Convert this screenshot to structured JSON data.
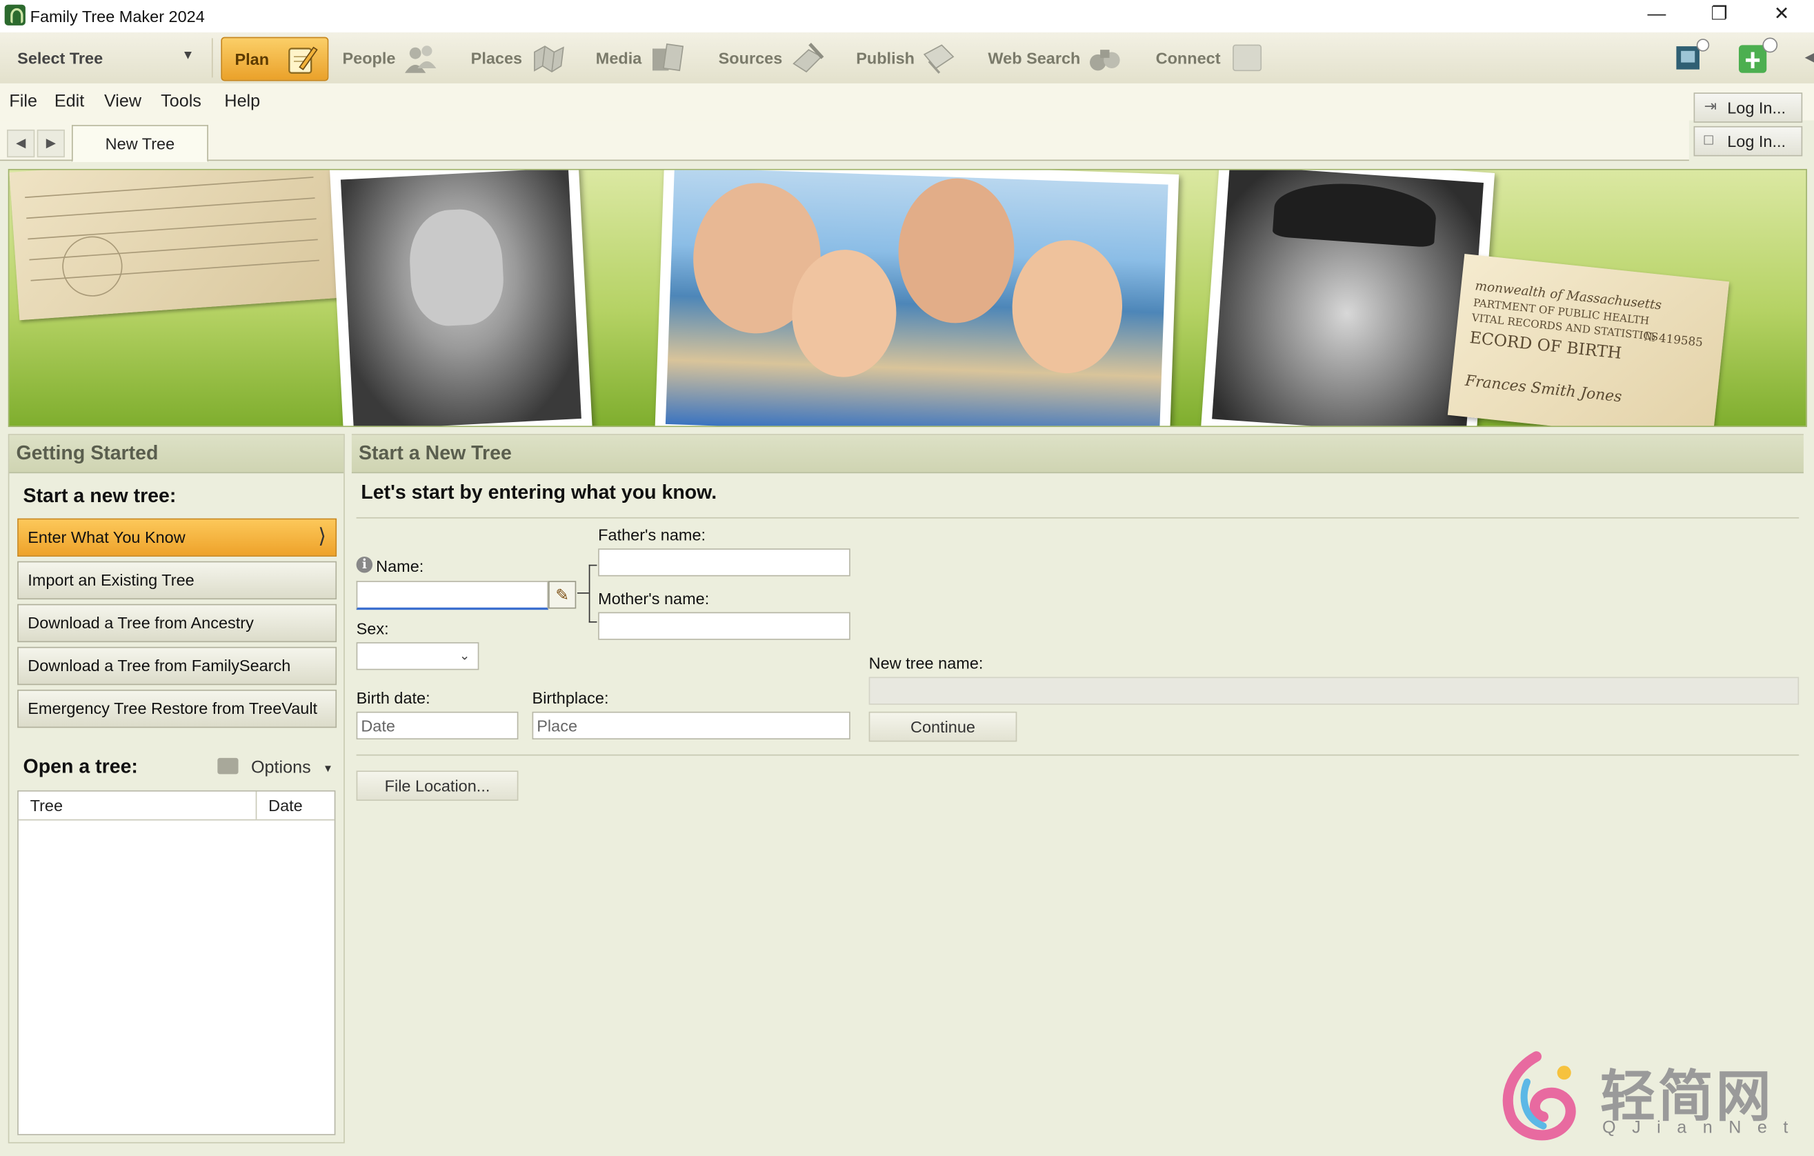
{
  "app": {
    "title": "Family Tree Maker 2024"
  },
  "toolbar": {
    "select_tree": "Select Tree",
    "items": [
      {
        "label": "Plan"
      },
      {
        "label": "People"
      },
      {
        "label": "Places"
      },
      {
        "label": "Media"
      },
      {
        "label": "Sources"
      },
      {
        "label": "Publish"
      },
      {
        "label": "Web Search"
      },
      {
        "label": "Connect"
      }
    ]
  },
  "menu": [
    "File",
    "Edit",
    "View",
    "Tools",
    "Help"
  ],
  "login": [
    "Log In...",
    "Log In..."
  ],
  "tabs": [
    {
      "label": "New Tree"
    }
  ],
  "banner": {
    "doc_right_text": [
      "monwealth of Massachusetts",
      "PARTMENT OF PUBLIC HEALTH",
      "VITAL RECORDS AND STATISTICS",
      "ECORD OF BIRTH",
      "№ 419585",
      "Frances Smith Jones"
    ]
  },
  "left_panel": {
    "header": "Getting Started",
    "start_title": "Start a new tree:",
    "buttons": [
      "Enter What You Know",
      "Import an Existing Tree",
      "Download a Tree from Ancestry",
      "Download a Tree from FamilySearch",
      "Emergency Tree Restore from TreeVault"
    ],
    "open_title": "Open a tree:",
    "options": "Options",
    "columns": [
      "Tree",
      "Date"
    ]
  },
  "right_panel": {
    "header": "Start a New Tree",
    "intro": "Let's start by entering what you know.",
    "name_label": "Name:",
    "father_label": "Father's name:",
    "mother_label": "Mother's name:",
    "sex_label": "Sex:",
    "birth_date_label": "Birth date:",
    "birth_date_placeholder": "Date",
    "birthplace_label": "Birthplace:",
    "birthplace_placeholder": "Place",
    "new_tree_name_label": "New tree name:",
    "continue_label": "Continue",
    "file_location_label": "File Location..."
  },
  "watermark": {
    "text": "轻简网",
    "sub": "QJianNet"
  },
  "colors": {
    "accent": "#f0a82c",
    "panel_bg": "#eceedd",
    "header_bg": "#d6dabb"
  }
}
